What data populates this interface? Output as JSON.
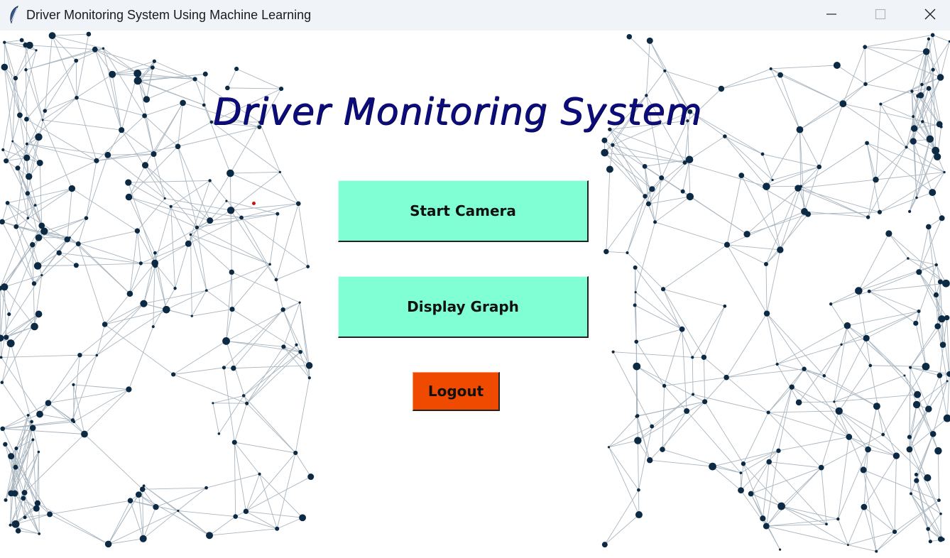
{
  "window": {
    "title": "Driver Monitoring System Using Machine Learning",
    "app_icon": "feather-icon",
    "controls": {
      "minimize_icon": "minimize-icon",
      "maximize_icon": "maximize-icon",
      "close_icon": "close-icon"
    }
  },
  "main": {
    "heading": "Driver Monitoring System",
    "buttons": {
      "start_camera": "Start Camera",
      "display_graph": "Display Graph",
      "logout": "Logout"
    }
  },
  "colors": {
    "heading": "#0c0c7a",
    "primary_button": "#80ffd4",
    "logout_button": "#f04a00",
    "titlebar": "#f0f4f9",
    "network_nodes": "#0d2a44",
    "network_lines": "#aab6c0"
  },
  "background": {
    "pattern": "network-nodes-and-lines"
  }
}
